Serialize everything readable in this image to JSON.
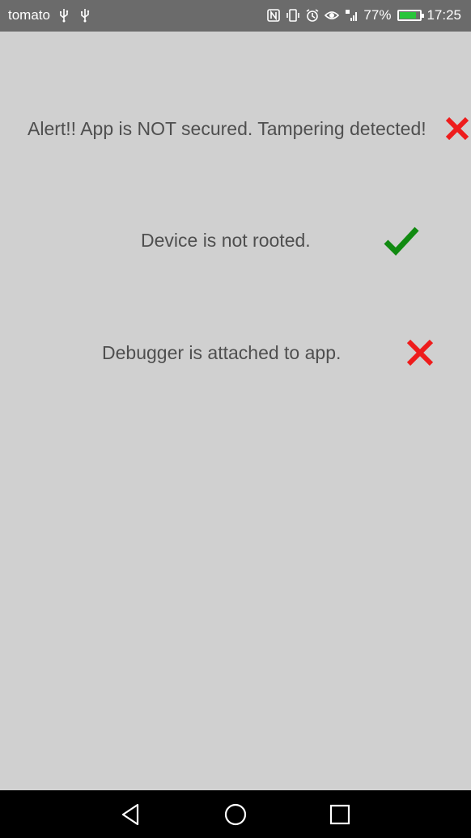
{
  "status_bar": {
    "carrier": "tomato",
    "battery_percent": "77%",
    "battery_level": 0.77,
    "time": "17:25",
    "icons": [
      "usb-icon",
      "usb-icon",
      "nfc-icon",
      "vibrate-icon",
      "alarm-icon",
      "eye-comfort-icon",
      "signal-4g-icon",
      "battery-charging-icon"
    ]
  },
  "checks": [
    {
      "label": "Alert!! App is NOT secured. Tampering detected!",
      "status": "fail",
      "icon": "cross-icon"
    },
    {
      "label": "Device is not rooted.",
      "status": "pass",
      "icon": "check-icon"
    },
    {
      "label": "Debugger is attached to app.",
      "status": "fail",
      "icon": "cross-icon"
    }
  ],
  "colors": {
    "background": "#d0d0d0",
    "status_bar": "#6b6b6b",
    "text": "#4f4f4f",
    "fail": "#ee1c1c",
    "pass": "#118a11",
    "nav_bar": "#000000"
  },
  "nav_bar": {
    "buttons": [
      "back-icon",
      "home-icon",
      "recents-icon"
    ]
  }
}
